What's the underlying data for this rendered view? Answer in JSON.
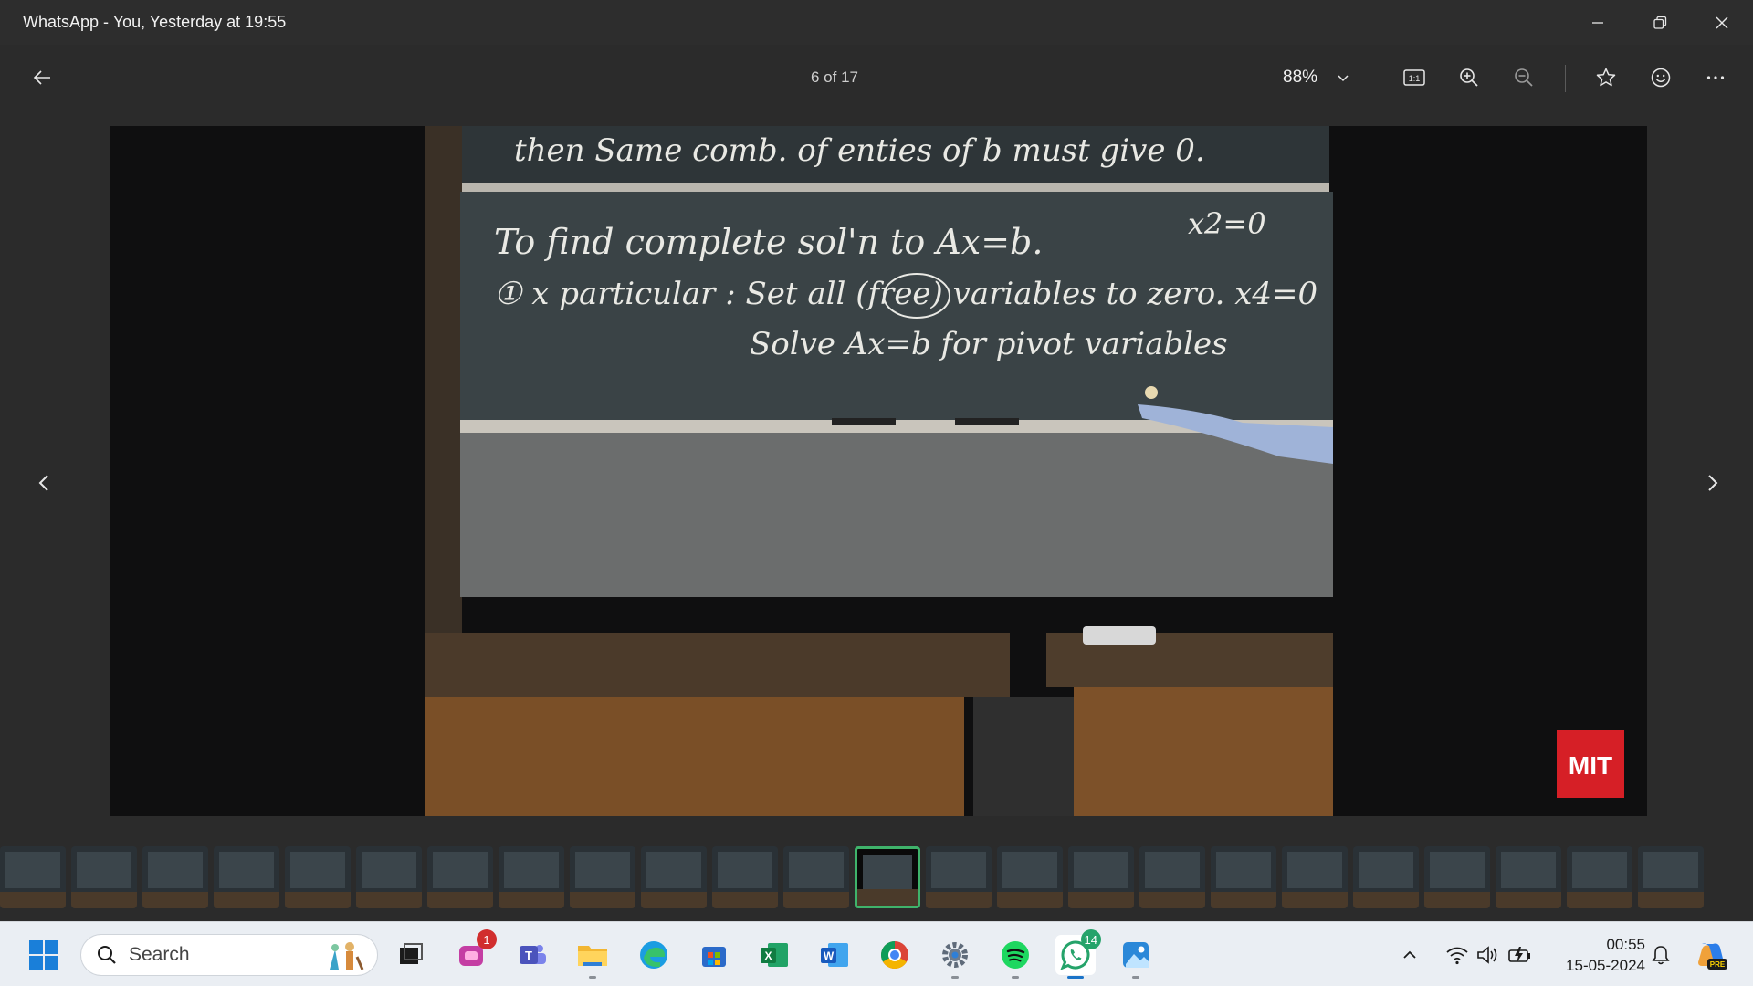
{
  "window": {
    "title": "WhatsApp - You, Yesterday at 19:55"
  },
  "toolbar": {
    "counter": "6 of 17",
    "zoom": "88%"
  },
  "image": {
    "board_lines": [
      "then Same comb. of enties of b must give 0.",
      "To find complete sol'n to Ax=b.",
      "x2=0",
      "① x particular : Set all (free) variables to zero. x4=0",
      "Solve Ax=b for pivot variables"
    ],
    "logo_text": "MIT"
  },
  "filmstrip": {
    "count": 24,
    "active_index": 12
  },
  "taskbar": {
    "search_placeholder": "Search",
    "badges": {
      "copilot_app": "1",
      "whatsapp": "14"
    },
    "clock_time": "00:55",
    "clock_date": "15-05-2024",
    "copilot_label": "PRE"
  },
  "colors": {
    "accent_active": "#3fb36b",
    "badge_red": "#d12e2e",
    "whatsapp_green": "#25a36a"
  }
}
